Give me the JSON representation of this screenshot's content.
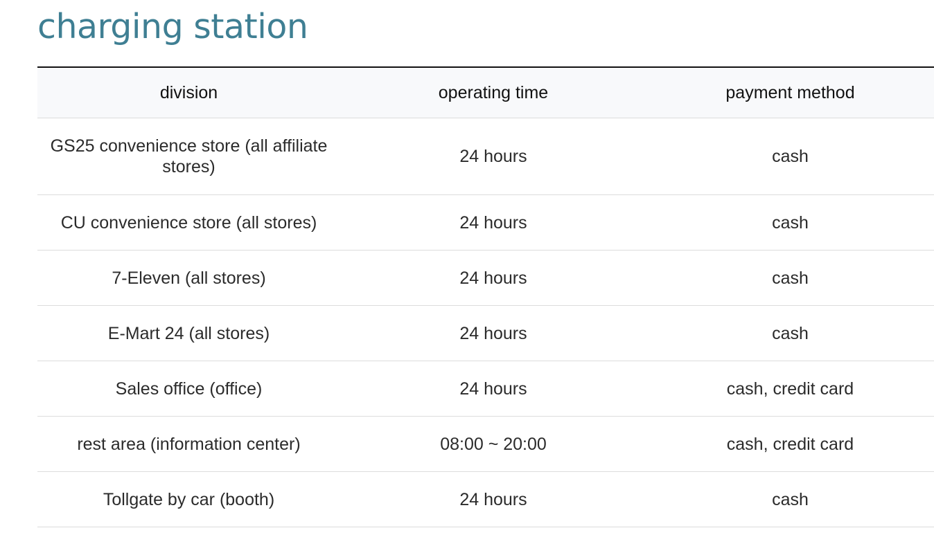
{
  "page": {
    "title": "charging station"
  },
  "table": {
    "headers": [
      "division",
      "operating time",
      "payment method"
    ],
    "rows": [
      [
        "GS25 convenience store (all affiliate stores)",
        "24 hours",
        "cash"
      ],
      [
        "CU convenience store (all stores)",
        "24 hours",
        "cash"
      ],
      [
        "7-Eleven (all stores)",
        "24 hours",
        "cash"
      ],
      [
        "E-Mart 24 (all stores)",
        "24 hours",
        "cash"
      ],
      [
        "Sales office (office)",
        "24 hours",
        "cash, credit card"
      ],
      [
        "rest area (information center)",
        "08:00 ~ 20:00",
        "cash, credit card"
      ],
      [
        "Tollgate by car (booth)",
        "24 hours",
        "cash"
      ]
    ]
  },
  "colors": {
    "title": "#3f7f93",
    "header_bg": "#f8f9fb",
    "top_rule": "#111111",
    "row_rule": "#dcdcdc"
  }
}
